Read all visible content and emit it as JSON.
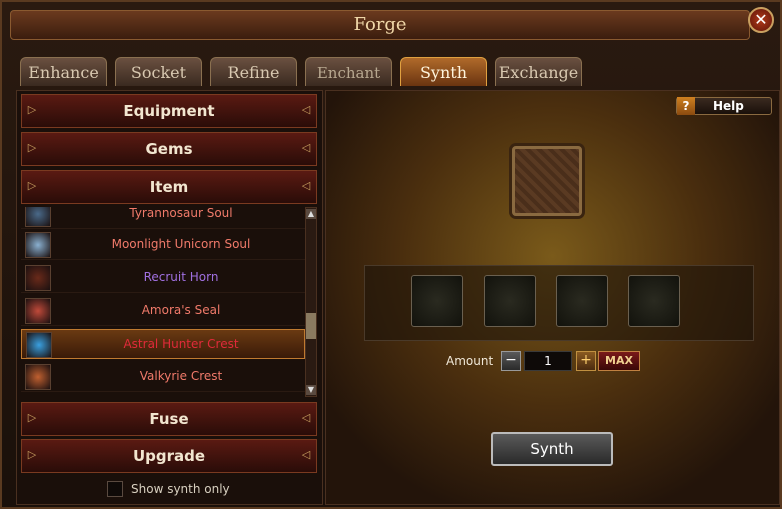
{
  "window": {
    "title": "Forge",
    "close_label": "✕"
  },
  "tabs": [
    {
      "label": "Enhance",
      "active": false
    },
    {
      "label": "Socket",
      "active": false
    },
    {
      "label": "Refine",
      "active": false
    },
    {
      "label": "Enchant",
      "active": false
    },
    {
      "label": "Synth",
      "active": true
    },
    {
      "label": "Exchange",
      "active": false
    }
  ],
  "categories": {
    "equipment": "Equipment",
    "gems": "Gems",
    "item": "Item",
    "fuse": "Fuse",
    "upgrade": "Upgrade"
  },
  "items": [
    {
      "name": "Tyrannosaur Soul",
      "color": "#f07a6a",
      "icon_color": "#4a6a8a"
    },
    {
      "name": "Moonlight Unicorn Soul",
      "color": "#f07a6a",
      "icon_color": "#8ab0d0"
    },
    {
      "name": "Recruit Horn",
      "color": "#a070e0",
      "icon_color": "#6a2a1a"
    },
    {
      "name": "Amora's Seal",
      "color": "#f07a6a",
      "icon_color": "#c04a3a"
    },
    {
      "name": "Astral Hunter Crest",
      "color": "#e02a3a",
      "icon_color": "#3aa0e0",
      "selected": true
    },
    {
      "name": "Valkyrie Crest",
      "color": "#f07a6a",
      "icon_color": "#c06030"
    }
  ],
  "filter": {
    "show_synth_only_label": "Show synth only",
    "checked": false
  },
  "help": {
    "icon": "?",
    "label": "Help"
  },
  "amount": {
    "label": "Amount",
    "value": "1",
    "minus": "−",
    "plus": "+",
    "max_label": "MAX"
  },
  "synth_button": "Synth"
}
